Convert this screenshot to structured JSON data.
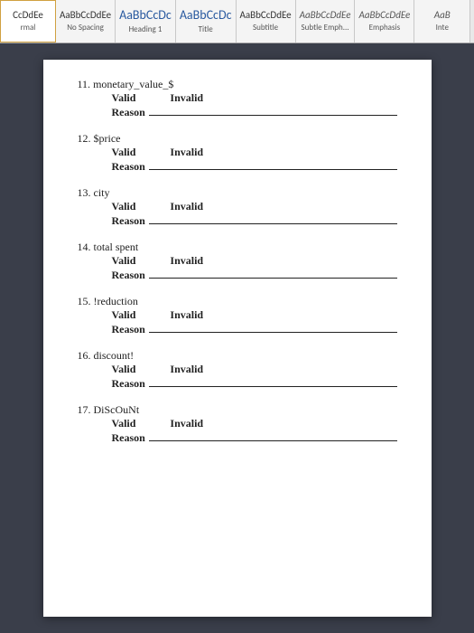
{
  "ribbon": {
    "styles": [
      {
        "preview": "CcDdEe",
        "name": "rmal",
        "cls": ""
      },
      {
        "preview": "AaBbCcDdEe",
        "name": "No Spacing",
        "cls": ""
      },
      {
        "preview": "AaBbCcDc",
        "name": "Heading 1",
        "cls": "large"
      },
      {
        "preview": "AaBbCcDc",
        "name": "Title",
        "cls": "large"
      },
      {
        "preview": "AaBbCcDdEe",
        "name": "Subtitle",
        "cls": ""
      },
      {
        "preview": "AaBbCcDdEe",
        "name": "Subtle Emph...",
        "cls": "italic"
      },
      {
        "preview": "AaBbCcDdEe",
        "name": "Emphasis",
        "cls": "italic"
      },
      {
        "preview": "AaB",
        "name": "Inte",
        "cls": "italic"
      }
    ]
  },
  "doc": {
    "valid_label": "Valid",
    "invalid_label": "Invalid",
    "reason_label": "Reason",
    "questions": [
      {
        "num": "11.",
        "text": "monetary_value_$"
      },
      {
        "num": "12.",
        "text": "$price"
      },
      {
        "num": "13.",
        "text": "city"
      },
      {
        "num": "14.",
        "text": "total spent"
      },
      {
        "num": "15.",
        "text": "!reduction"
      },
      {
        "num": "16.",
        "text": "discount!"
      },
      {
        "num": "17.",
        "text": "DiScOuNt"
      }
    ]
  }
}
